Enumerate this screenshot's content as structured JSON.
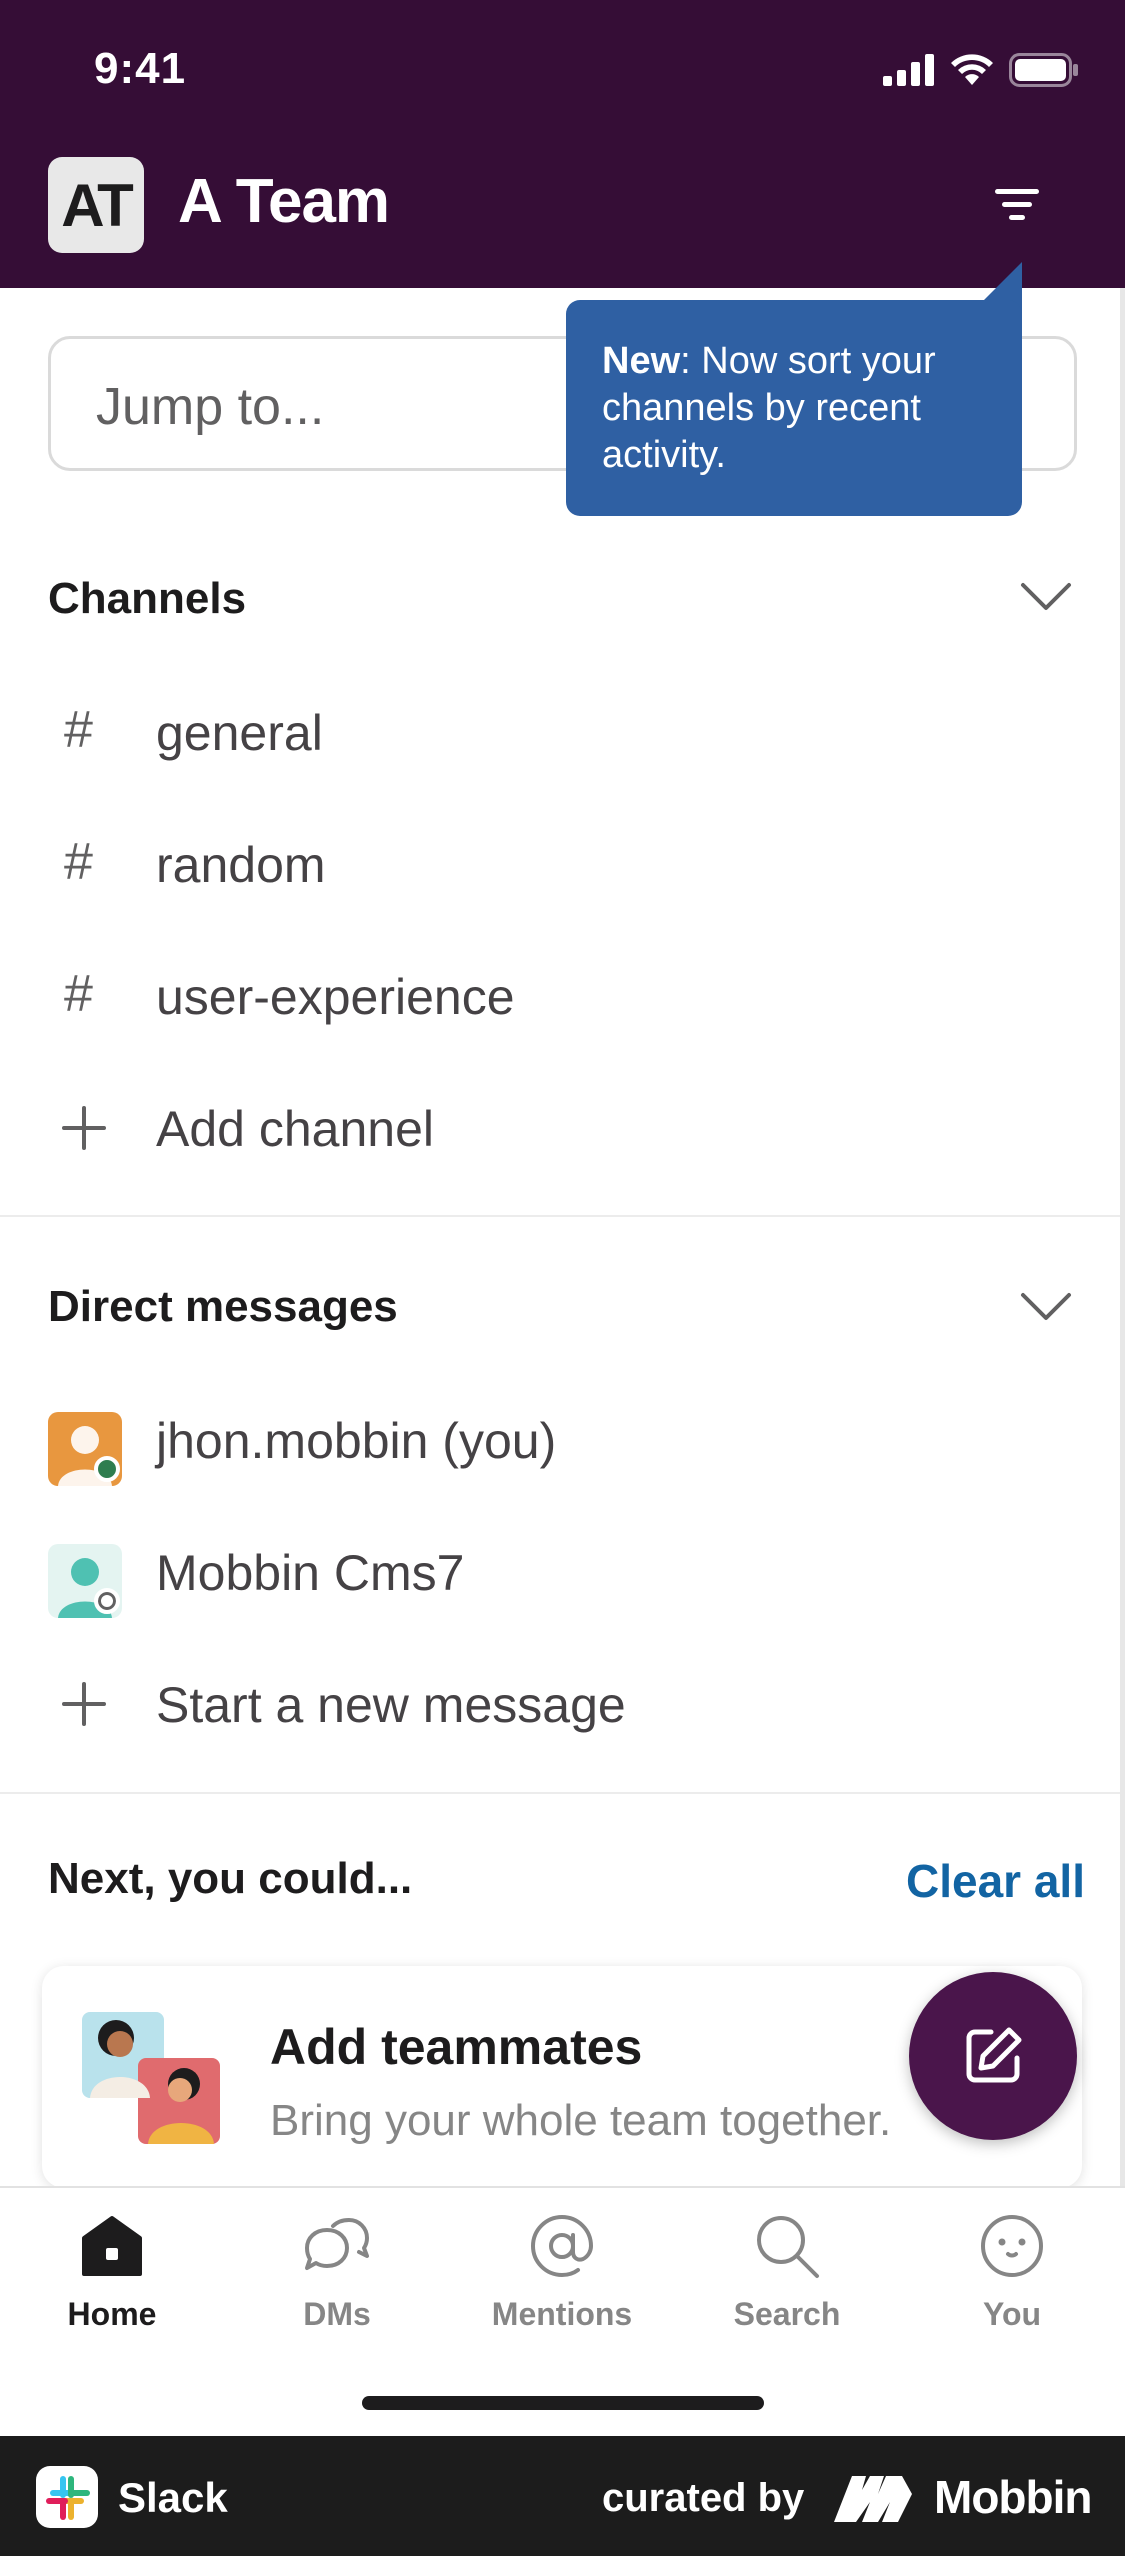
{
  "status_bar": {
    "time": "9:41"
  },
  "workspace": {
    "initials": "AT",
    "name": "A Team"
  },
  "jump": {
    "placeholder": "Jump to..."
  },
  "tooltip": {
    "bold": "New",
    "text": ": Now sort your channels by recent activity."
  },
  "channels": {
    "title": "Channels",
    "items": [
      {
        "prefix": "#",
        "label": "general"
      },
      {
        "prefix": "#",
        "label": "random"
      },
      {
        "prefix": "#",
        "label": "user-experience"
      }
    ],
    "add_label": "Add channel"
  },
  "dms": {
    "title": "Direct messages",
    "items": [
      {
        "label": "jhon.mobbin (you)",
        "presence": "active"
      },
      {
        "label": "Mobbin Cms7",
        "presence": "away"
      }
    ],
    "new_label": "Start a new message"
  },
  "next": {
    "title": "Next, you could...",
    "clear_all": "Clear all",
    "card": {
      "title": "Add teammates",
      "subtitle": "Bring your whole team together."
    }
  },
  "tabs": [
    {
      "label": "Home",
      "icon": "home-icon",
      "active": true
    },
    {
      "label": "DMs",
      "icon": "dms-icon",
      "active": false
    },
    {
      "label": "Mentions",
      "icon": "mentions-icon",
      "active": false
    },
    {
      "label": "Search",
      "icon": "search-icon",
      "active": false
    },
    {
      "label": "You",
      "icon": "you-icon",
      "active": false
    }
  ],
  "footer": {
    "app_name": "Slack",
    "curated_by": "curated by",
    "brand": "Mobbin"
  },
  "colors": {
    "header": "#350d36",
    "accent": "#1264a3",
    "tooltip": "#2f60a3",
    "fab": "#4a154b"
  }
}
